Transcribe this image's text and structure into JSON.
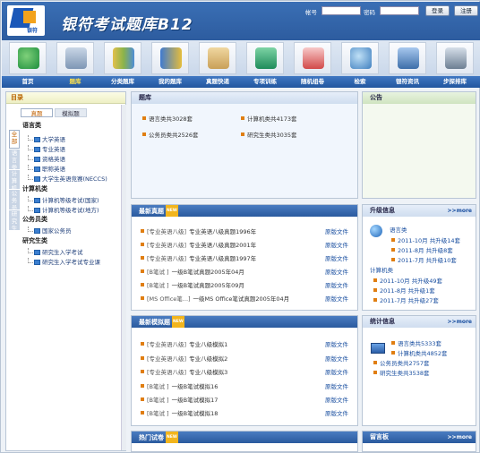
{
  "header": {
    "brand_title": "银符考试题库B12",
    "logo_sub": "银符",
    "account_label": "帐号",
    "password_label": "密码",
    "login_button": "登录",
    "register_button": "注册"
  },
  "nav": [
    "首页",
    "题库",
    "分类题库",
    "我的题库",
    "真题快递",
    "专项训练",
    "随机组卷",
    "检索",
    "银符资讯",
    "步探排库"
  ],
  "nav_active": 1,
  "left": {
    "title": "目录",
    "tabs": [
      "真题",
      "模拟题"
    ],
    "vertical_tabs": [
      "全部",
      "语言类",
      "计算机类",
      "公务员类",
      "研究生类"
    ],
    "categories": [
      {
        "name": "语言类",
        "items": [
          "大学英语",
          "专业英语",
          "资格英语",
          "职称英语",
          "大学生英语竞赛(NECCS)"
        ]
      },
      {
        "name": "计算机类",
        "items": [
          "计算机等级考试(国家)",
          "计算机等级考试(地方)"
        ]
      },
      {
        "name": "公务员类",
        "items": [
          "国家公务员"
        ]
      },
      {
        "name": "研究生类",
        "items": [
          "研究生入学考试",
          "研究生入学考试专业课"
        ]
      }
    ]
  },
  "tiku": {
    "title": "题库",
    "items": [
      "语言类共3028套",
      "计算机类共4173套",
      "公务员类共2526套",
      "研究生类共3035套"
    ]
  },
  "notice": {
    "title": "公告"
  },
  "newest_real": {
    "title": "最新真题",
    "source_label": "原版文件",
    "rows": [
      {
        "tag": "[专业英语八级]",
        "name": "专业英语八级真题1996年"
      },
      {
        "tag": "[专业英语八级]",
        "name": "专业英语八级真题2001年"
      },
      {
        "tag": "[专业英语八级]",
        "name": "专业英语八级真题1997年"
      },
      {
        "tag": "[B笔试       ]",
        "name": "一级B笔试真题2005年04月"
      },
      {
        "tag": "[B笔试       ]",
        "name": "一级B笔试真题2005年09月"
      },
      {
        "tag": "[MS Office笔...]",
        "name": "一级MS Office笔试真题2005年04月"
      }
    ]
  },
  "newest_mock": {
    "title": "最新模拟题",
    "source_label": "原版文件",
    "rows": [
      {
        "tag": "[专业英语八级]",
        "name": "专业八级模拟1"
      },
      {
        "tag": "[专业英语八级]",
        "name": "专业八级模拟2"
      },
      {
        "tag": "[专业英语八级]",
        "name": "专业八级模拟3"
      },
      {
        "tag": "[B笔试       ]",
        "name": "一级B笔试模拟16"
      },
      {
        "tag": "[B笔试       ]",
        "name": "一级B笔试模拟17"
      },
      {
        "tag": "[B笔试       ]",
        "name": "一级B笔试模拟18"
      }
    ]
  },
  "hot": {
    "title": "热门试卷"
  },
  "upgrade": {
    "title": "升级信息",
    "more": ">>more",
    "groups": [
      {
        "name": "语言类",
        "rows": [
          "2011-10月 共升级14套",
          "2011-8月 共升级8套",
          "2011-7月 共升级10套"
        ]
      },
      {
        "name": "计算机类",
        "rows": [
          "2011-10月 共升级49套",
          "2011-8月 共升级1套",
          "2011-7月 共升级27套"
        ]
      }
    ]
  },
  "stats": {
    "title": "统计信息",
    "more": ">>more",
    "rows": [
      "语言类共5333套",
      "计算机类共4852套",
      "公务员类共2757套",
      "研究生类共3538套"
    ]
  },
  "guestbook": {
    "title": "留言板",
    "more": ">>more"
  },
  "colors": {
    "nav_blue": "#2d5c9f",
    "accent_orange": "#e07e12",
    "active_nav": "#ffe24a"
  }
}
